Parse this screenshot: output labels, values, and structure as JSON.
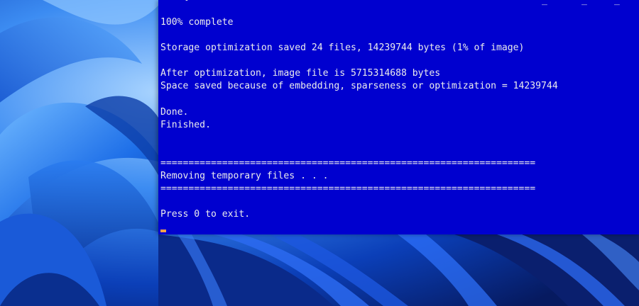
{
  "console": {
    "lines": [
      "100% complete",
      "",
      "Storage optimization saved 24 files, 14239744 bytes (1% of image)",
      "",
      "After optimization, image file is 5715314688 bytes",
      "Space saved because of embedding, sparseness or optimization = 14239744",
      "",
      "Done.",
      "Finished.",
      "",
      "",
      "===================================================================",
      "Removing temporary files . . .",
      "===================================================================",
      "",
      "Press 0 to exit."
    ]
  }
}
